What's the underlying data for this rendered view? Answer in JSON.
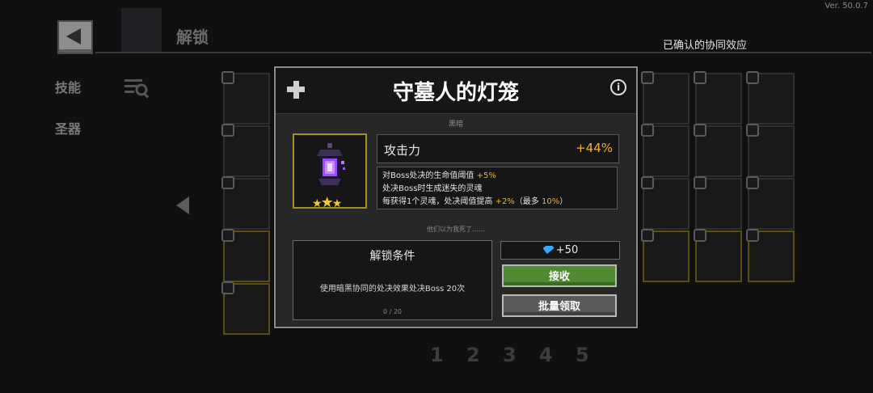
{
  "version": "Ver. 50.0.7",
  "header": {
    "title": "解锁",
    "confirmed_label": "已确认的协同效应"
  },
  "sidebar": {
    "items": [
      {
        "label": "技能"
      },
      {
        "label": "圣器"
      }
    ]
  },
  "pagination": [
    "1",
    "2",
    "3",
    "4",
    "5"
  ],
  "modal": {
    "title": "守墓人的灯笼",
    "element": "黑暗",
    "stat": {
      "name": "攻击力",
      "value": "+44%"
    },
    "description": {
      "line1_prefix": "对Boss处决的生命值阈值",
      "line1_value": "+5%",
      "line2": "处决Boss时生成迷失的灵魂",
      "line3_prefix": "每获得1个灵魂，处决阈值提高",
      "line3_value": "+2%",
      "line3_mid": "（最多",
      "line3_max": "10%",
      "line3_suffix": "）"
    },
    "flavor": "他们以为我死了……",
    "unlock": {
      "title": "解锁条件",
      "text": "使用暗黑协同的处决效果处决Boss 20次",
      "progress": "0 / 20"
    },
    "reward": {
      "icon": "gem-icon",
      "amount": "+50"
    },
    "buttons": {
      "receive": "接收",
      "batch": "批量领取"
    },
    "item_stars": 3
  },
  "colors": {
    "highlight": "#f2b12e",
    "receive_button": "#4f8a33",
    "item_border": "#a58f25"
  }
}
